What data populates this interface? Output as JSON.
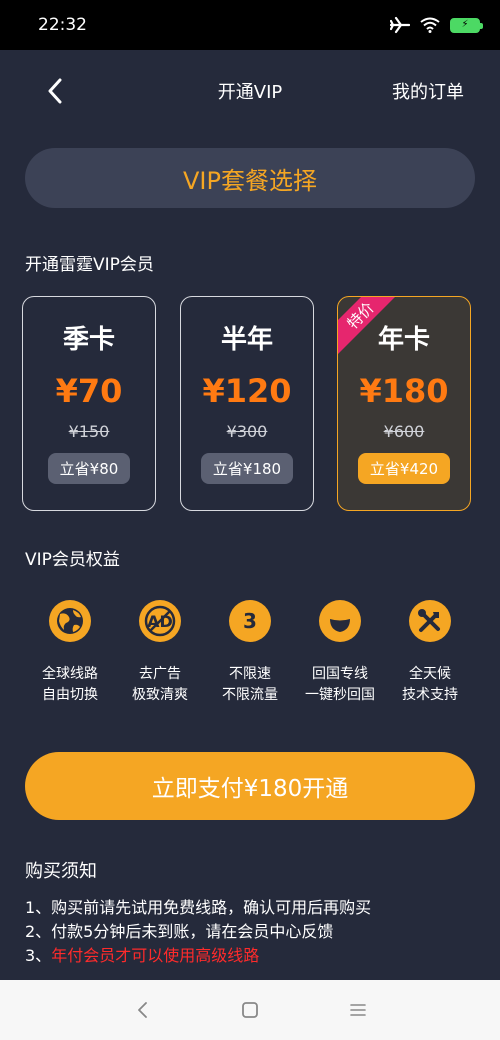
{
  "status_bar": {
    "time": "22:32"
  },
  "nav": {
    "title": "开通VIP",
    "orders": "我的订单"
  },
  "banner": {
    "label": "VIP套餐选择"
  },
  "section": {
    "plans_label": "开通雷霆VIP会员",
    "benefits_label": "VIP会员权益"
  },
  "plans": [
    {
      "name": "季卡",
      "price": "¥70",
      "original": "¥150",
      "save": "立省¥80",
      "selected": false
    },
    {
      "name": "半年",
      "price": "¥120",
      "original": "¥300",
      "save": "立省¥180",
      "selected": false
    },
    {
      "name": "年卡",
      "price": "¥180",
      "original": "¥600",
      "save": "立省¥420",
      "selected": true,
      "badge": "特价"
    }
  ],
  "benefits": [
    {
      "icon": "globe-icon",
      "line1": "全球线路",
      "line2": "自由切换"
    },
    {
      "icon": "no-ads-icon",
      "line1": "去广告",
      "line2": "极致清爽"
    },
    {
      "icon": "unlimited-icon",
      "icon_text": "3",
      "line1": "不限速",
      "line2": "不限流量"
    },
    {
      "icon": "return-home-icon",
      "line1": "回国专线",
      "line2": "一键秒回国"
    },
    {
      "icon": "tools-icon",
      "line1": "全天候",
      "line2": "技术支持"
    }
  ],
  "pay_button": {
    "label": "立即支付¥180开通"
  },
  "notice": {
    "title": "购买须知",
    "items": [
      "1、购买前请先试用免费线路，确认可用后再购买",
      "2、付款5分钟后未到账，请在会员中心反馈"
    ],
    "item3_prefix": "3、",
    "item3_text": "年付会员才可以使用高级线路"
  },
  "colors": {
    "accent": "#f5a623",
    "price": "#ff7a12",
    "background": "#252a3b",
    "ribbon": "#e6266e",
    "warning": "#ff2b2b"
  }
}
